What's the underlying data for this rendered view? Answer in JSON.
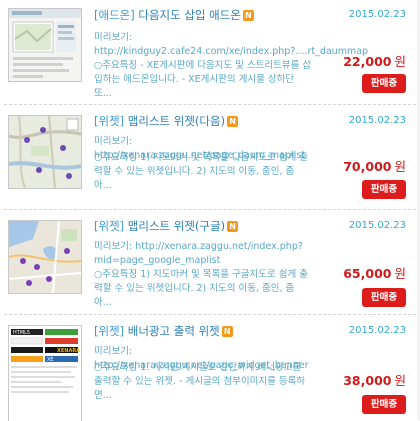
{
  "items": [
    {
      "category": "[애드온]",
      "title": "다음지도 삽입 애드온",
      "badge": "N",
      "date": "2015.02.23",
      "preview_label": "미리보기:",
      "preview_url": "http://kindguy2.cafe24.com/xe/index.php?....rt_daummap",
      "description": "○주요특징 - XE게시판에 다음지도 및 스트리트뷰를 삽입하는 애드온입니다. - XE게시판의 게시물 상하단 또...",
      "price": "22,000",
      "unit": "원",
      "button": "판매중"
    },
    {
      "category": "[위젯]",
      "title": "맵리스트 위젯(다음)",
      "badge": "N",
      "date": "2015.02.23",
      "preview_label": "미리보기:",
      "preview_url": "http://xenara.zaggu.net/page_daum_maplist",
      "description": "○주요특징 1) 지도마커 및 목록을 다음지도로 쉽게 출력할 수 있는 위젯입니다. 2) 지도의 이동, 줌인, 줌아...",
      "price": "70,000",
      "unit": "원",
      "button": "판매중"
    },
    {
      "category": "[위젯]",
      "title": "맵리스트 위젯(구글)",
      "badge": "N",
      "date": "2015.02.23",
      "preview_label": "미리보기:",
      "preview_url": "http://xenara.zaggu.net/index.php?mid=page_google_maplist",
      "description": "○주요특징 1) 지도마커 및 목록을 구글지도로 쉽게 출력할 수 있는 위젯입니다. 2) 지도의 이동, 줌인, 줌아...",
      "price": "65,000",
      "unit": "원",
      "button": "판매중"
    },
    {
      "category": "[위젯]",
      "title": "배너광고 출력 위젯",
      "badge": "N",
      "date": "2015.02.23",
      "preview_label": "미리보기:",
      "preview_url": "http://xenara.zaggu.net/page_widget_banner",
      "description": "○주요특징 1. 게시판 게시글로 간단하게 배너광고를 출력할 수 있는 위젯. - 게시글의 첨부이미지를 등록하면...",
      "price": "38,000",
      "unit": "원",
      "button": "판매중"
    }
  ],
  "banner_thumb": {
    "logos": [
      "HTML5",
      "XE",
      "XENARA"
    ]
  }
}
